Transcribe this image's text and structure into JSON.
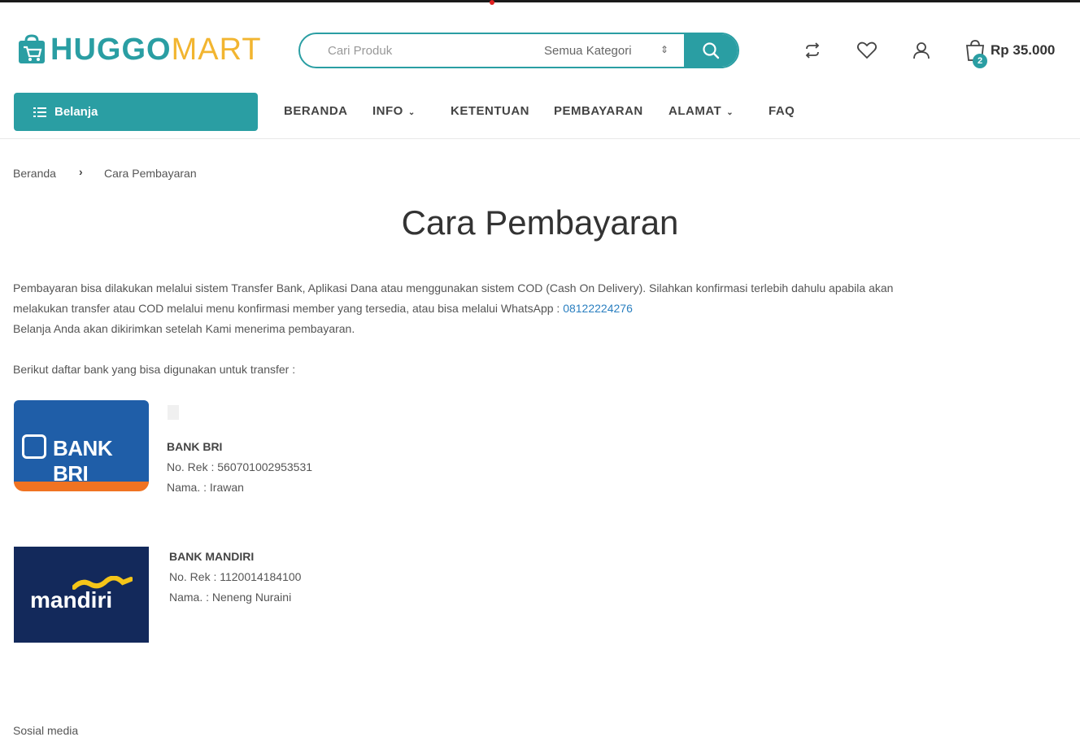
{
  "brand": {
    "word1": "HUGGO",
    "word2": "MART",
    "teal": "#2a9ea3",
    "yellow": "#f2b530"
  },
  "search": {
    "placeholder": "Cari Produk",
    "category": "Semua Kategori",
    "sort_glyph": "⇕",
    "button_icon": "search-icon"
  },
  "header_icons": [
    "compare-icon",
    "heart-icon",
    "user-icon",
    "cart-icon"
  ],
  "cart": {
    "count": "2",
    "total": "Rp 35.000"
  },
  "nav": {
    "shop_label": "Belanja",
    "items": [
      {
        "label": "BERANDA",
        "has_dropdown": false
      },
      {
        "label": "INFO",
        "has_dropdown": true
      },
      {
        "label": "KETENTUAN",
        "has_dropdown": false
      },
      {
        "label": "PEMBAYARAN",
        "has_dropdown": false
      },
      {
        "label": "ALAMAT",
        "has_dropdown": true
      },
      {
        "label": "FAQ",
        "has_dropdown": false
      }
    ]
  },
  "breadcrumb": {
    "home": "Beranda",
    "separator": "›",
    "current": "Cara Pembayaran"
  },
  "page": {
    "title": "Cara Pembayaran",
    "para1_line1": "Pembayaran bisa dilakukan melalui sistem Transfer Bank, Aplikasi Dana atau menggunakan sistem COD (Cash On Delivery).  Silahkan konfirmasi terlebih dahulu apabila akan",
    "para1_line2": "melakukan transfer atau COD melalui menu konfirmasi member yang tersedia, atau bisa melalui WhatsApp : ",
    "whatsapp": "08122224276",
    "para1_line3": "Belanja Anda akan dikirimkan setelah Kami menerima pembayaran.",
    "bank_intro": "Berikut daftar bank yang bisa digunakan untuk transfer :"
  },
  "banks": [
    {
      "logo_text": "BANK BRI",
      "name": "BANK BRI",
      "rek": "No. Rek : 560701002953531",
      "holder": "Nama.    : Irawan"
    },
    {
      "logo_text": "mandiri",
      "name": "BANK MANDIRI",
      "rek": "No. Rek : 1120014184100",
      "holder": "Nama.    : Neneng Nuraini"
    }
  ],
  "footer_peek": "Sosial media"
}
